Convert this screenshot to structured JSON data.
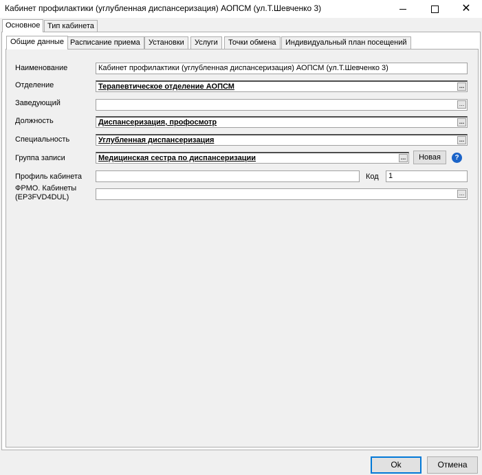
{
  "window": {
    "title": "Кабинет профилактики (углубленная диспансеризация) АОПСМ (ул.Т.Шевченко 3)"
  },
  "outer_tabs": [
    "Основное",
    "Тип кабинета"
  ],
  "inner_tabs": [
    "Общие данные",
    "Расписание приема",
    "Установки",
    "Услуги",
    "Точки обмена",
    "Индивидуальный план посещений"
  ],
  "form": {
    "name_label": "Наименование",
    "name_value": "Кабинет профилактики (углубленная диспансеризация) АОПСМ (ул.Т.Шевченко 3)",
    "department_label": "Отделение",
    "department_value": "Терапевтическое отделение АОПСМ",
    "head_label": "Заведующий",
    "head_value": "",
    "position_label": "Должность",
    "position_value": "Диспансеризация, профосмотр",
    "specialty_label": "Специальность",
    "specialty_value": "Углубленная диспансеризация",
    "group_label": "Группа записи",
    "group_value": "Медицинская сестра по диспансеризации",
    "new_button": "Новая",
    "profile_label": "Профиль кабинета",
    "profile_value": "",
    "code_label": "Код",
    "code_value": "1",
    "frmo_label_1": "ФРМО. Кабинеты",
    "frmo_label_2": "(EP3FVD4DUL)",
    "frmo_value": "",
    "ellipsis": "...",
    "help_glyph": "?"
  },
  "footer": {
    "ok": "Ok",
    "cancel": "Отмена"
  },
  "icons": {
    "minimize": "minimize-icon",
    "maximize": "maximize-icon",
    "close": "close-icon",
    "help": "help-icon"
  }
}
